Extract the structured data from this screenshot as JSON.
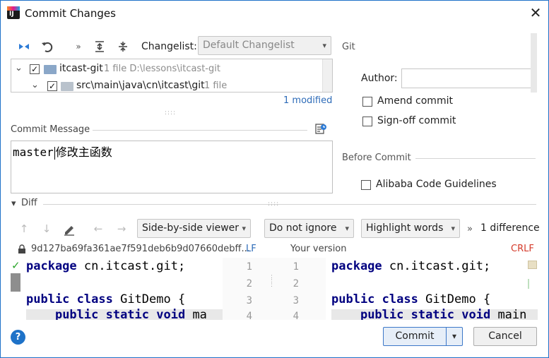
{
  "window": {
    "title": "Commit Changes",
    "close_glyph": "✕"
  },
  "changes": {
    "changelist_label": "Changelist:",
    "changelist_value": "Default Changelist",
    "tree": {
      "root_name": "itcast-git",
      "root_meta": "1 file  D:\\lessons\\itcast-git",
      "child_path": "src\\main\\java\\cn\\itcast\\git",
      "child_meta": "1 file"
    },
    "modified_link": "1 modified"
  },
  "git_panel": {
    "section_label": "Git",
    "author_label": "Author:",
    "author_value": "",
    "amend_commit": "Amend commit",
    "signoff_commit": "Sign-off commit"
  },
  "before_commit": {
    "section_label": "Before Commit",
    "alibaba": "Alibaba Code Guidelines"
  },
  "commit_message": {
    "label": "Commit Message",
    "text_ascii": "master",
    "text_cn": "修改主函数"
  },
  "diff": {
    "label": "Diff",
    "viewer_select": "Side-by-side viewer",
    "ignore_select": "Do not ignore",
    "highlight_select": "Highlight words",
    "difference_count": "1 difference",
    "left_revision": "9d127ba69fa361ae7f591deb6b9d07660debff...",
    "left_line_ending": "LF",
    "right_title": "Your version",
    "right_line_ending": "CRLF",
    "left_lines": [
      "package cn.itcast.git;",
      "",
      "public class GitDemo {",
      "    public static void ma"
    ],
    "right_lines": [
      "package cn.itcast.git;",
      "",
      "public class GitDemo {",
      "    public static void main"
    ],
    "line_numbers": [
      "1",
      "2",
      "3",
      "4"
    ]
  },
  "buttons": {
    "commit": "Commit",
    "cancel": "Cancel",
    "help": "?"
  },
  "colors": {
    "accent": "#1e72c8",
    "link": "#2d6bb8",
    "crlf": "#d43a2a",
    "keyword": "#000080",
    "green_check": "#2aa52a"
  }
}
